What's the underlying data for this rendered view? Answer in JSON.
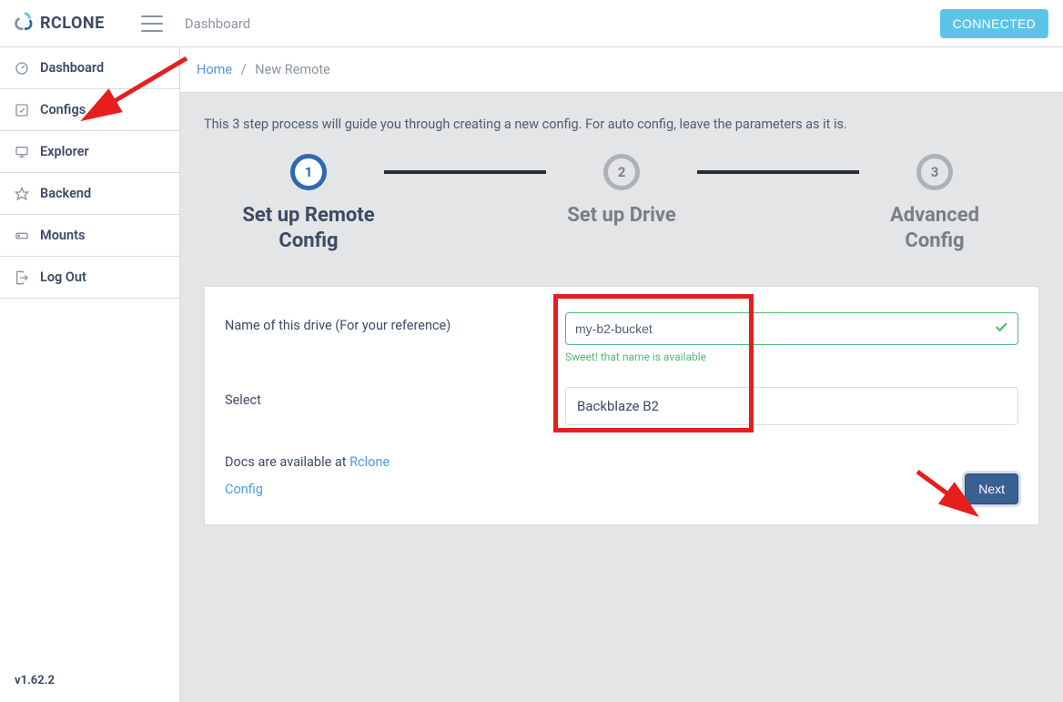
{
  "header": {
    "brand": "RCLONE",
    "page_title": "Dashboard",
    "status_button": "CONNECTED"
  },
  "sidebar": {
    "items": [
      {
        "label": "Dashboard",
        "icon": "speedometer"
      },
      {
        "label": "Configs",
        "icon": "edit-square"
      },
      {
        "label": "Explorer",
        "icon": "monitor"
      },
      {
        "label": "Backend",
        "icon": "star"
      },
      {
        "label": "Mounts",
        "icon": "drive"
      },
      {
        "label": "Log Out",
        "icon": "logout"
      }
    ],
    "version": "v1.62.2"
  },
  "breadcrumb": {
    "home": "Home",
    "current": "New Remote"
  },
  "wizard": {
    "intro": "This 3 step process will guide you through creating a new config. For auto config, leave the parameters as it is.",
    "steps": [
      {
        "num": "1",
        "title": "Set up Remote Config",
        "active": true
      },
      {
        "num": "2",
        "title": "Set up Drive",
        "active": false
      },
      {
        "num": "3",
        "title": "Advanced Config",
        "active": false
      }
    ],
    "form": {
      "name_label": "Name of this drive (For your reference)",
      "name_value": "my-b2-bucket",
      "name_help": "Sweet! that name is available",
      "select_label": "Select",
      "select_value": "Backblaze B2",
      "docs_prefix": "Docs are available at ",
      "docs_link": "Rclone Config",
      "next_button": "Next"
    }
  }
}
